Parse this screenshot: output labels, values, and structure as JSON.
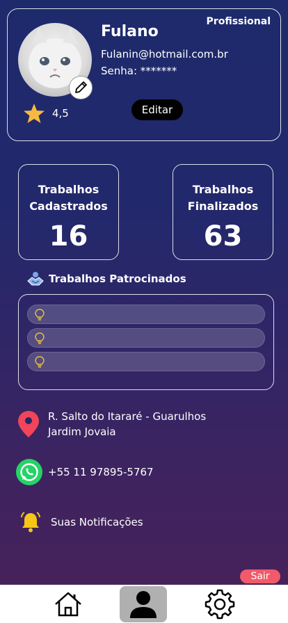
{
  "profile": {
    "name": "Fulano",
    "role": "Profissional",
    "email": "Fulanin@hotmail.com.br",
    "password_line": "Senha: *******",
    "rating": "4,5",
    "edit_label": "Editar"
  },
  "stats": [
    {
      "label_line1": "Trabalhos",
      "label_line2": "Cadastrados",
      "value": "16"
    },
    {
      "label_line1": "Trabalhos",
      "label_line2": "Finalizados",
      "value": "63"
    }
  ],
  "sponsored": {
    "title": "Trabalhos Patrocinados",
    "items": [
      "",
      "",
      ""
    ]
  },
  "address": {
    "line1": "R. Salto do Itararé - Guarulhos",
    "line2": "Jardim Jovaia"
  },
  "phone": "+55 11 97895-5767",
  "notifications_label": "Suas Notificações",
  "logout_label": "Sair",
  "nav": {
    "items": [
      {
        "icon": "home-icon",
        "active": false
      },
      {
        "icon": "user-icon",
        "active": true
      },
      {
        "icon": "gear-icon",
        "active": false
      }
    ]
  },
  "colors": {
    "accent_logout": "#f05a6a",
    "star": "#f5b942",
    "location_pin": "#f0455a",
    "whatsapp": "#25d366",
    "bell": "#f5c518"
  }
}
